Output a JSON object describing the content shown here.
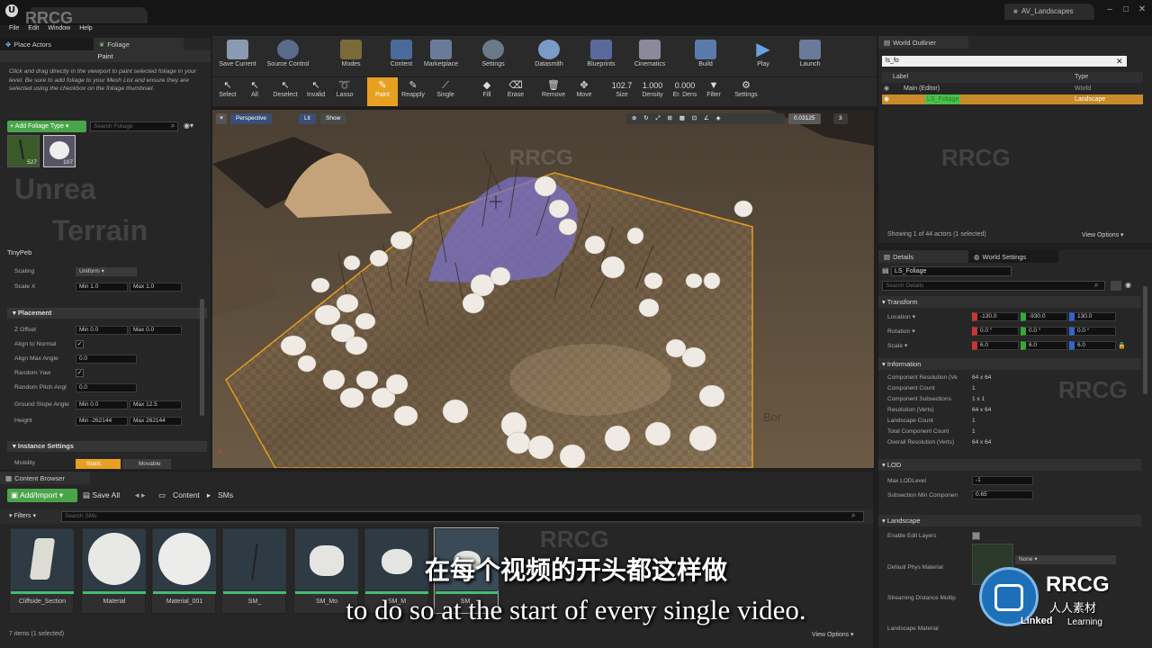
{
  "titlebar": {
    "logo": "U",
    "project_tab": "AV_Landscapes",
    "watermark": "RRCG"
  },
  "menu": [
    "File",
    "Edit",
    "Window",
    "Help"
  ],
  "left_panel": {
    "tabs": [
      "Place Actors",
      "Foliage"
    ],
    "mode_header": "Paint",
    "help_text": "Click and drag directly in the viewport to paint selected foliage in your level. Be sure to add foliage to your Mesh List and ensure they are selected using the checkbox on the foliage thumbnail.",
    "add_foliage_label": "+ Add Foliage Type ▾",
    "search_placeholder": "Search Foliage",
    "foliage_items": [
      {
        "count": "527"
      },
      {
        "count": "107"
      }
    ],
    "selected_type": "TinyPeb",
    "scaling_label": "Scaling",
    "scaling_value": "Uniform",
    "scale_x_label": "Scale X",
    "scale_x_min": "Min 1.0",
    "scale_x_max": "Max 1.0",
    "placement_header": "Placement",
    "z_offset_label": "Z Offset",
    "z_offset_min": "Min 0.0",
    "z_offset_max": "Max 0.0",
    "align_normal_label": "Align to Normal",
    "align_max_angle_label": "Align Max Angle",
    "align_max_angle_value": "0.0",
    "random_yaw_label": "Random Yaw",
    "random_pitch_label": "Random Pitch Angl",
    "random_pitch_value": "0.0",
    "ground_slope_label": "Ground Slope Angle",
    "ground_slope_min": "Min 0.0",
    "ground_slope_max": "Max 12.5",
    "height_label": "Height",
    "height_min": "Min -262144",
    "height_max": "Max 262144",
    "instance_header": "Instance Settings",
    "mobility_label": "Mobility",
    "mobility_static": "Static",
    "mobility_movable": "Movable"
  },
  "toolbar": {
    "buttons": [
      "Save Current",
      "Source Control",
      "Modes",
      "Content",
      "Marketplace",
      "Settings",
      "Datasmith",
      "Blueprints",
      "Cinematics",
      "Build",
      "Play",
      "Launch"
    ]
  },
  "mode_toolbar": {
    "tools": [
      "Select",
      "All",
      "Deselect",
      "Invalid",
      "Lasso",
      "Paint",
      "Reapply",
      "Single",
      "Fill",
      "Erase",
      "Remove",
      "Move"
    ],
    "size_value": "102.7",
    "size_label": "Size",
    "density_value": "1.000",
    "density_label": "Density",
    "erdens_value": "0.000",
    "erdens_label": "Er. Dens",
    "filter_label": "Filter",
    "settings_label": "Settings"
  },
  "viewport": {
    "perspective": "Perspective",
    "lit": "Lit",
    "show": "Show",
    "snap_value": "0.03125",
    "camera_speed": "3",
    "bg_text_1": "Unreal",
    "bg_text_2": "Terrain Tech"
  },
  "outliner": {
    "tab": "World Outliner",
    "search_value": "ls_fo",
    "col_label": "Label",
    "col_type": "Type",
    "rows": [
      {
        "label": "Main (Editor)",
        "type": "World"
      },
      {
        "label": "LS_Foliage",
        "type": "Landscape"
      }
    ],
    "status": "Showing 1 of 44 actors (1 selected)",
    "view_options": "View Options ▾"
  },
  "details": {
    "tabs": [
      "Details",
      "World Settings"
    ],
    "name": "LS_Foliage",
    "search_placeholder": "Search Details",
    "transform_header": "Transform",
    "location_label": "Location ▾",
    "location": [
      "-130.0",
      "-930.0",
      "130.0"
    ],
    "rotation_label": "Rotation ▾",
    "rotation": [
      "0.0 °",
      "0.0 °",
      "0.0 °"
    ],
    "scale_label": "Scale ▾",
    "scale": [
      "6.0",
      "6.0",
      "6.0"
    ],
    "information_header": "Information",
    "info": [
      {
        "k": "Component Resolution (Ve",
        "v": "64 x 64"
      },
      {
        "k": "Component Count",
        "v": "1"
      },
      {
        "k": "Component Subsections",
        "v": "1 x 1"
      },
      {
        "k": "Resolution (Verts)",
        "v": "64 x 64"
      },
      {
        "k": "Landscape Count",
        "v": "1"
      },
      {
        "k": "Total Component Count",
        "v": "1"
      },
      {
        "k": "Overall Resolution (Verts)",
        "v": "64 x 64"
      }
    ],
    "lod_header": "LOD",
    "max_lod_label": "Max LODLevel",
    "max_lod_value": "-1",
    "subsection_label": "Subsection Min Componen",
    "subsection_value": "0.65",
    "landscape_header": "Landscape",
    "enable_edit_layers": "Enable Edit Layers",
    "phys_material": "Default Phys Material",
    "phys_value": "None",
    "streaming_label": "Streaming Distance Multip",
    "landscape_material": "Landscape Material"
  },
  "content_browser": {
    "tab": "Content Browser",
    "add_import": "Add/Import ▾",
    "save_all": "Save All",
    "path": [
      "Content",
      "SMs"
    ],
    "filters": "Filters ▾",
    "search_placeholder": "Search SMs",
    "assets": [
      "Cliffside_Section",
      "Material",
      "Material_001",
      "SM_",
      "SM_Mo",
      "SM_M",
      "SM_"
    ],
    "status": "7 items (1 selected)",
    "view_options": "View Options ▾"
  },
  "subtitles": {
    "cn": "在每个视频的开头都这样做",
    "en": "to do so at the start of every single video."
  },
  "brand": {
    "rrcg": "RRCG",
    "rrcg_cn": "人人素材",
    "linkedin": "Linked",
    "learning": "Learning"
  },
  "colors": {
    "accent": "#f0a020",
    "selection": "#c98a2a",
    "add_green": "#4aa54a"
  }
}
